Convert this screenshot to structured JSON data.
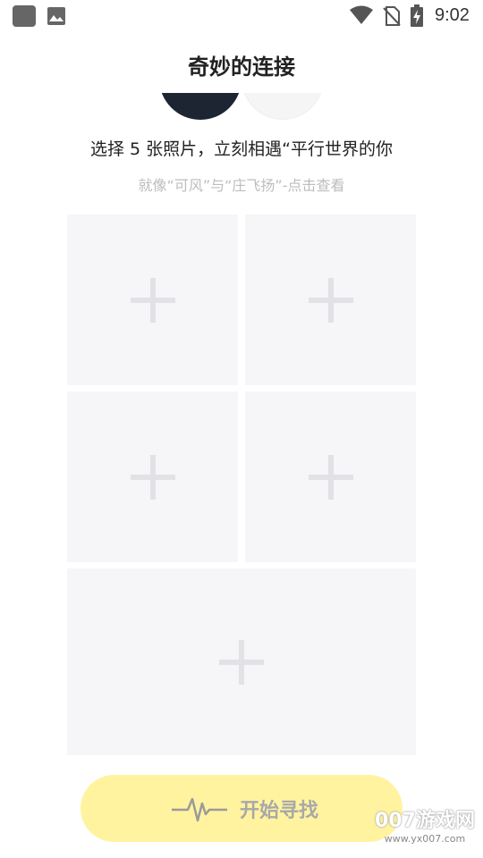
{
  "status_bar": {
    "time": "9:02"
  },
  "header": {
    "title": "奇妙的连接"
  },
  "intro": {
    "subtitle": "选择 5 张照片，立刻相遇“平行世界的你",
    "hint": "就像“可风”与“庄飞扬”-点击查看"
  },
  "photo_slots": [
    {
      "icon": "plus-icon"
    },
    {
      "icon": "plus-icon"
    },
    {
      "icon": "plus-icon"
    },
    {
      "icon": "plus-icon"
    },
    {
      "icon": "plus-icon"
    }
  ],
  "start_button": {
    "label": "开始寻找",
    "icon": "pulse-icon",
    "color": "#fff3a0"
  },
  "watermark": {
    "brand": "007游戏网",
    "url": "www.yx007.com"
  }
}
